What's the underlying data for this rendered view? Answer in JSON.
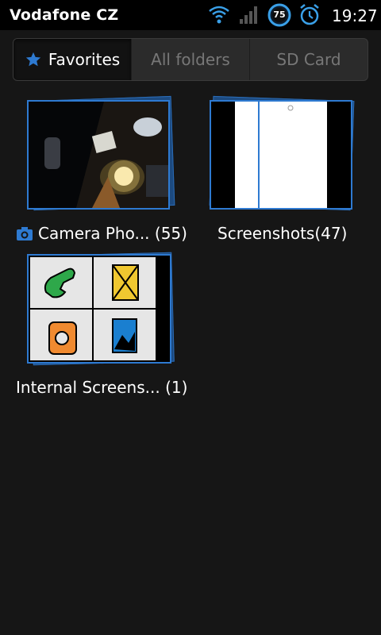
{
  "status_bar": {
    "carrier": "Vodafone CZ",
    "battery_level": "75",
    "time": "19:27"
  },
  "tabs": [
    {
      "label": "Favorites",
      "icon": "star-icon",
      "active": true
    },
    {
      "label": "All folders",
      "active": false
    },
    {
      "label": "SD Card",
      "active": false
    }
  ],
  "albums": [
    {
      "name": "Camera Pho...",
      "count": "(55)",
      "icon": "camera-icon"
    },
    {
      "name": "Screenshots",
      "count": "(47)"
    },
    {
      "name": "Internal Screens...",
      "count": "(1)"
    }
  ],
  "colors": {
    "accent": "#2e7ad1",
    "background": "#161616",
    "status_bar": "#000000"
  }
}
